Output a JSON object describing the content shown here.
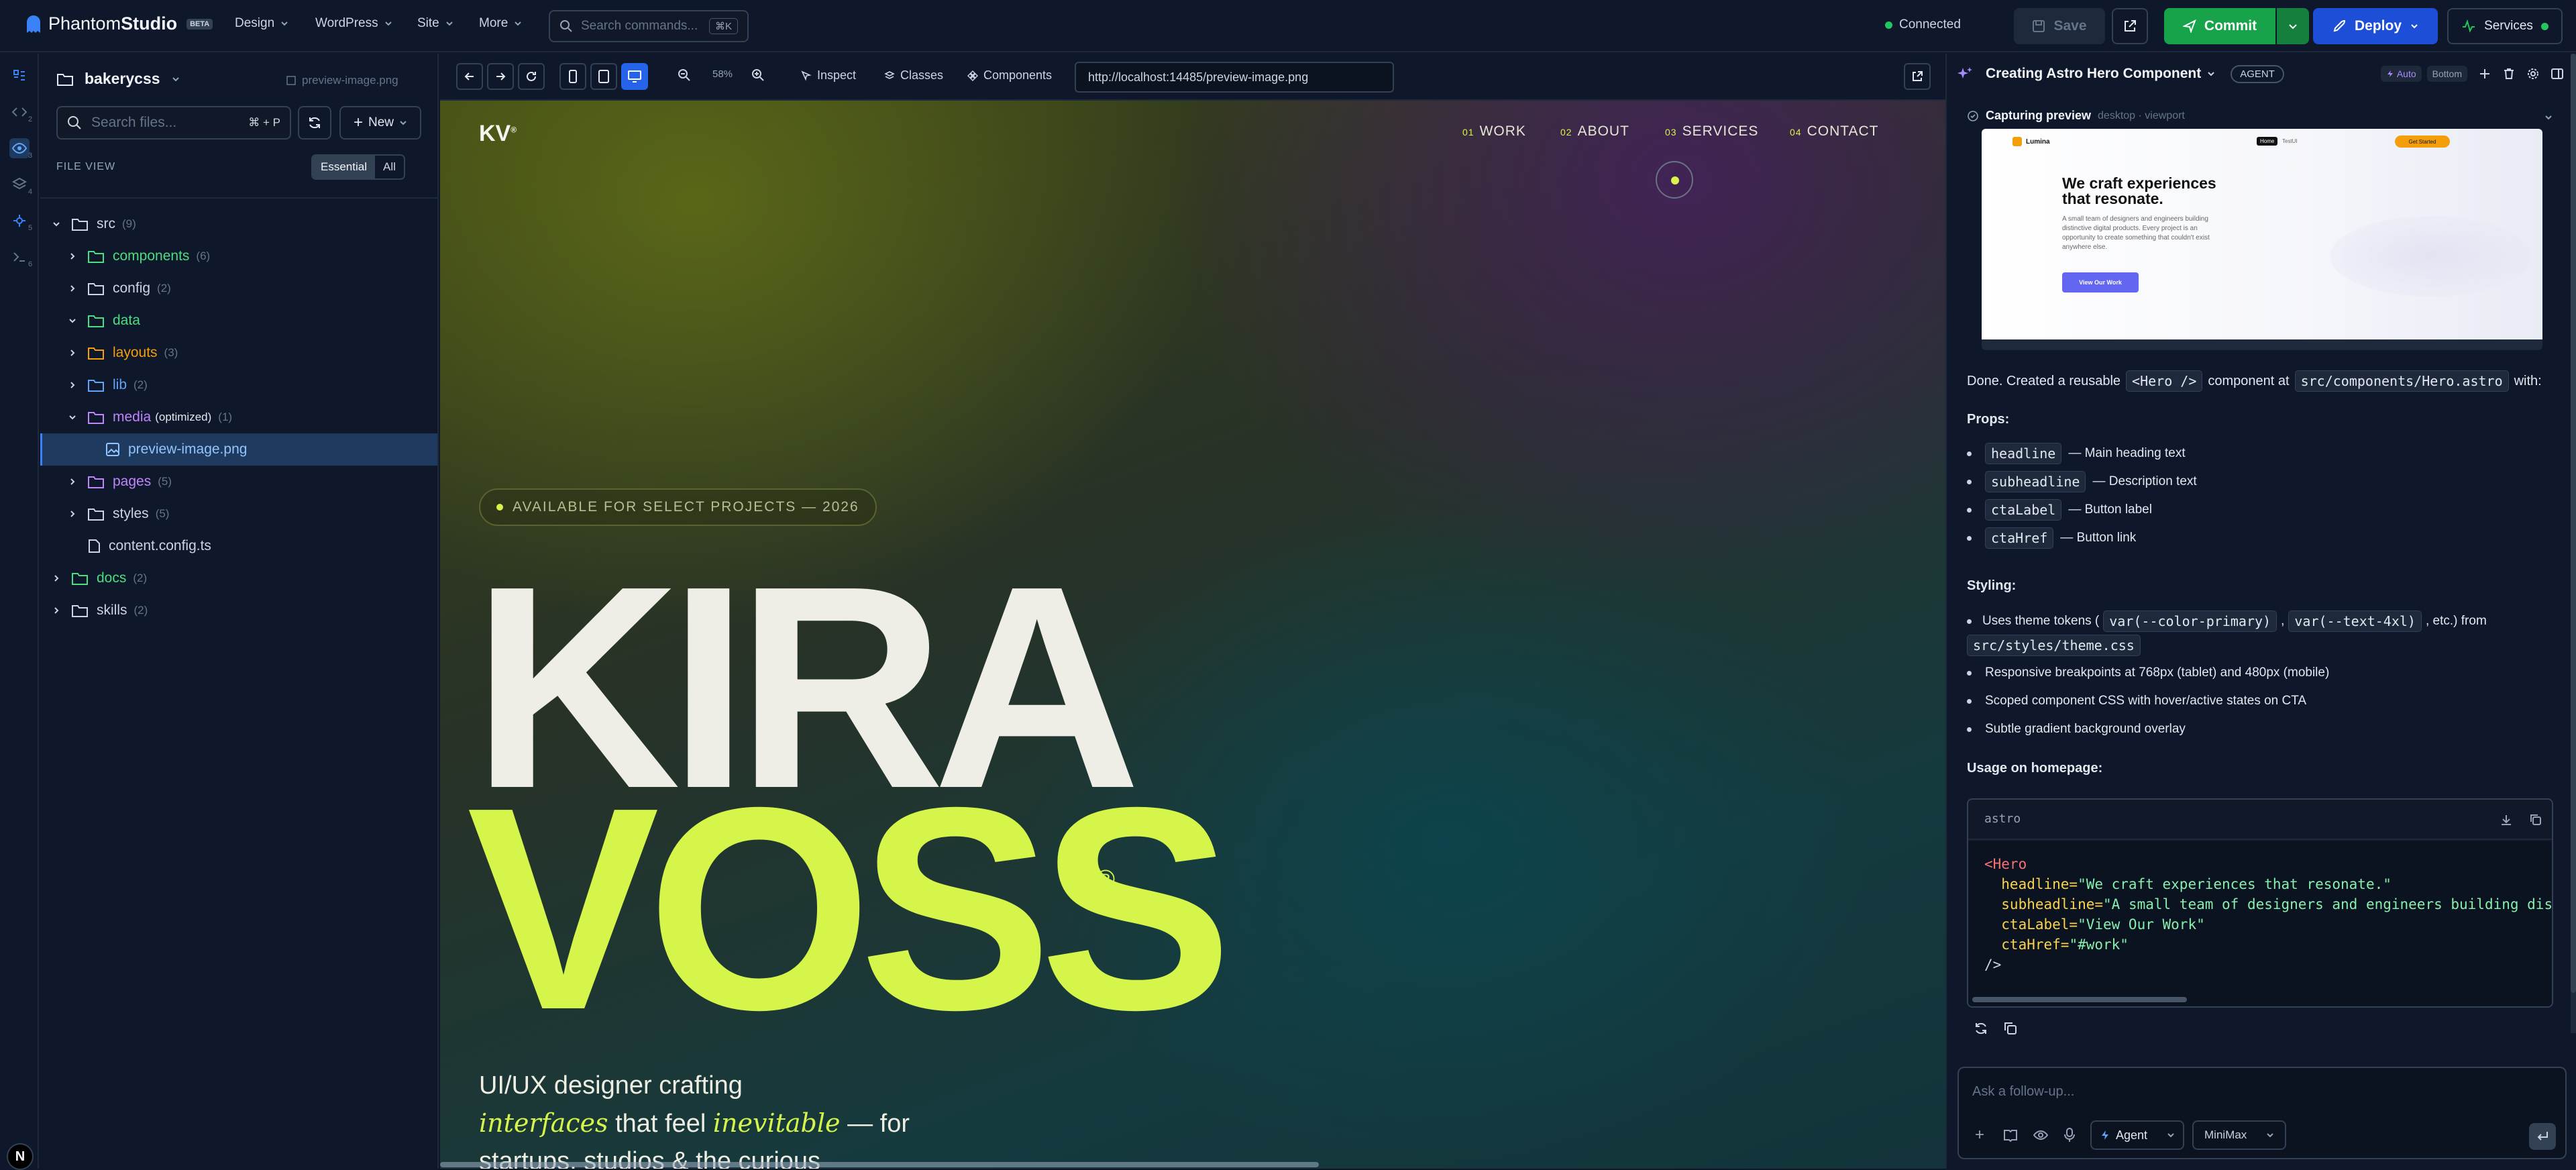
{
  "app": {
    "brand_a": "Phantom",
    "brand_b": "Studio",
    "beta": "BETA"
  },
  "topmenu": [
    "Design",
    "WordPress",
    "Site",
    "More"
  ],
  "command": {
    "placeholder": "Search commands...",
    "shortcut": "⌘K"
  },
  "status": {
    "text": "Connected",
    "color": "#22c55e"
  },
  "actions": {
    "save": "Save",
    "commit": "Commit",
    "deploy": "Deploy",
    "services": "Services"
  },
  "rail": {
    "numbers": [
      "2",
      "3",
      "4",
      "5",
      "6"
    ]
  },
  "files": {
    "project": "bakerycss",
    "open_file": "preview-image.png",
    "search_placeholder": "Search files...",
    "search_shortcut": "⌘ + P",
    "new_label": "New",
    "file_view_label": "FILE VIEW",
    "view_modes": [
      "Essential",
      "All"
    ],
    "tree": [
      {
        "name": "src",
        "count": "(9)",
        "color": "#cbd5e1"
      },
      {
        "name": "components",
        "count": "(6)",
        "color": "#4ade80"
      },
      {
        "name": "config",
        "count": "(2)",
        "color": "#cbd5e1"
      },
      {
        "name": "data",
        "count": "",
        "color": "#4ade80"
      },
      {
        "name": "layouts",
        "count": "(3)",
        "color": "#f59e0b"
      },
      {
        "name": "lib",
        "count": "(2)",
        "color": "#60a5fa"
      },
      {
        "name": "media",
        "extra": "(optimized)",
        "count": "(1)",
        "color": "#c084fc"
      },
      {
        "name": "preview-image.png",
        "count": "",
        "color": "#93c5fd"
      },
      {
        "name": "pages",
        "count": "(5)",
        "color": "#c084fc"
      },
      {
        "name": "styles",
        "count": "(5)",
        "color": "#cbd5e1"
      },
      {
        "name": "content.config.ts",
        "count": "",
        "color": "#cbd5e1"
      },
      {
        "name": "docs",
        "count": "(2)",
        "color": "#4ade80"
      },
      {
        "name": "skills",
        "count": "(2)",
        "color": "#cbd5e1"
      }
    ]
  },
  "preview_toolbar": {
    "zoom": "58%",
    "inspect": "Inspect",
    "classes": "Classes",
    "components": "Components",
    "url": "http://localhost:14485/preview-image.png"
  },
  "site": {
    "logo": "KV",
    "logo_mark": "®",
    "nav": [
      {
        "num": "01",
        "label": "WORK"
      },
      {
        "num": "02",
        "label": "ABOUT"
      },
      {
        "num": "03",
        "label": "SERVICES"
      },
      {
        "num": "04",
        "label": "CONTACT"
      }
    ],
    "availability": "AVAILABLE FOR SELECT PROJECTS — 2026",
    "name_first": "KIRA",
    "name_last": "VOSS",
    "registered": "®",
    "tagline_1": "UI/UX designer crafting",
    "tagline_em1": "interfaces",
    "tagline_mid": " that feel ",
    "tagline_em2": "inevitable",
    "tagline_end": " — for",
    "tagline_3": "startups, studios & the curious"
  },
  "chat": {
    "title": "Creating Astro Hero Component",
    "badge": "AGENT",
    "auto": "Auto",
    "bottom": "Bottom",
    "capture_label": "Capturing preview",
    "capture_meta": "desktop · viewport",
    "thumb": {
      "brand": "Lumina",
      "nav_home": "Home",
      "nav_other": "TestUI",
      "cta_top": "Get Started",
      "headline_1": "We craft experiences",
      "headline_2": "that resonate.",
      "body_1": "A small team of designers and engineers building",
      "body_2": "distinctive digital products. Every project is an",
      "body_3": "opportunity to create something that couldn't exist",
      "body_4": "anywhere else.",
      "cta": "View Our Work"
    },
    "done_a": "Done. Created a reusable",
    "done_code1": "<Hero />",
    "done_b": "component at",
    "done_code2": "src/components/Hero.astro",
    "done_c": "with:",
    "props_label": "Props:",
    "props": [
      {
        "code": "headline",
        "desc": "— Main heading text"
      },
      {
        "code": "subheadline",
        "desc": "— Description text"
      },
      {
        "code": "ctaLabel",
        "desc": "— Button label"
      },
      {
        "code": "ctaHref",
        "desc": "— Button link"
      }
    ],
    "styling_label": "Styling:",
    "styling_1a": "Uses theme tokens (",
    "styling_1b": "var(--color-primary)",
    "styling_1c": ",",
    "styling_1d": "var(--text-4xl)",
    "styling_1e": ", etc.) from",
    "styling_1f": "src/styles/theme.css",
    "styling_2": "Responsive breakpoints at 768px (tablet) and 480px (mobile)",
    "styling_3": "Scoped component CSS with hover/active states on CTA",
    "styling_4": "Subtle gradient background overlay",
    "usage_label": "Usage on homepage:",
    "code_lang": "astro",
    "code": [
      {
        "k": "<Hero",
        "v": ""
      },
      {
        "k": "  headline=",
        "v": "\"We craft experiences that resonate.\""
      },
      {
        "k": "  subheadline=",
        "v": "\"A small team of designers and engineers building dis"
      },
      {
        "k": "  ctaLabel=",
        "v": "\"View Our Work\""
      },
      {
        "k": "  ctaHref=",
        "v": "\"#work\""
      },
      {
        "k": "/>",
        "v": ""
      }
    ],
    "ask_placeholder": "Ask a follow-up...",
    "mode": "Agent",
    "model": "MiniMax"
  }
}
